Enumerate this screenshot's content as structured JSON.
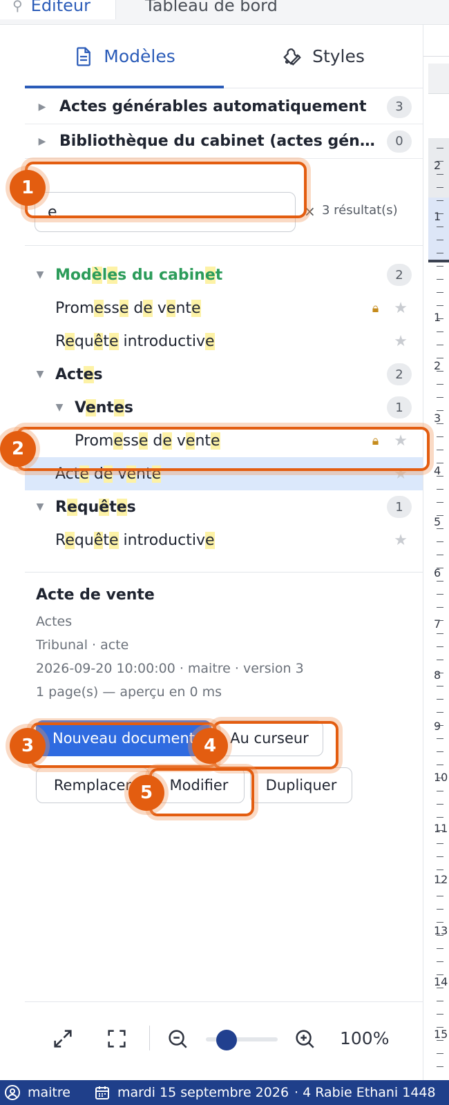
{
  "top_tabs": [
    {
      "label": "Editeur"
    },
    {
      "label": "Tableau de bord"
    }
  ],
  "panel_tabs": [
    {
      "label": "Modèles",
      "icon": "document-icon"
    },
    {
      "label": "Styles",
      "icon": "wrench-icon"
    }
  ],
  "sections": [
    {
      "label": "Actes générables automatiquement",
      "count": "3"
    },
    {
      "label": "Bibliothèque du cabinet (actes générables)",
      "count": "0"
    }
  ],
  "search": {
    "value": "e",
    "clear": "×",
    "results": "3 résultat(s)"
  },
  "tree": {
    "cabinet": {
      "label": "Modèles du cabinet",
      "count": "2"
    },
    "cabinet_item_1": "Promesse de vente",
    "cabinet_item_2": "Requête introductive",
    "actes": {
      "label": "Actes",
      "count": "2"
    },
    "ventes": {
      "label": "Ventes",
      "count": "1"
    },
    "ventes_item_1": "Promesse de vente",
    "actes_item_1": "Acte de vente",
    "requetes": {
      "label": "Requêtes",
      "count": "1"
    },
    "requetes_item_1": "Requête introductive"
  },
  "details": {
    "title": "Acte de vente",
    "category": "Actes",
    "meta": "Tribunal · acte",
    "version": "2026-09-20 10:00:00 · maitre · version 3",
    "preview": "1 page(s) — aperçu en 0 ms"
  },
  "actions": {
    "new_document": "Nouveau document",
    "at_cursor": "Au curseur",
    "replace": "Remplacer",
    "modify": "Modifier",
    "duplicate": "Dupliquer"
  },
  "zoom": {
    "percent": "100%",
    "level": 0.2
  },
  "ruler_numbers": [
    "2",
    "1",
    "1",
    "2",
    "3",
    "4",
    "5",
    "6",
    "7",
    "8",
    "9",
    "10",
    "11",
    "12",
    "13",
    "14",
    "15"
  ],
  "badges": [
    "1",
    "2",
    "3",
    "4",
    "5"
  ],
  "status": {
    "user": "maitre",
    "date": "mardi 15 septembre 2026",
    "address": "· 4 Rabie Ethani 1448"
  },
  "colors": {
    "accent": "#2a5bb8",
    "primary_button": "#2f6be0",
    "status_bar": "#1f3f8a",
    "callout": "#e35d10",
    "highlight": "#fdf2a6",
    "selected_row": "#dbe8fb",
    "category_green": "#2c9c5a"
  }
}
